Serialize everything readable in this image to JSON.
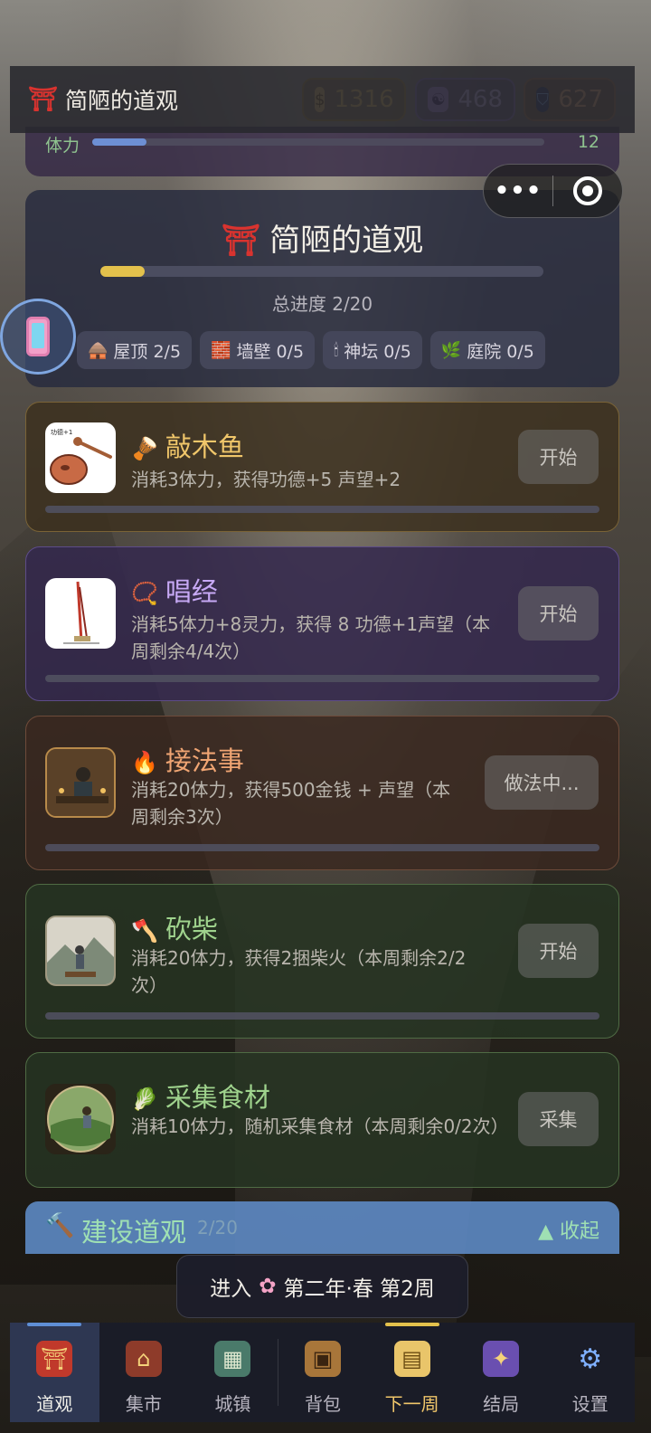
{
  "header": {
    "gate_icon": "torii-gate-icon",
    "title": "简陋的道观",
    "gold": "1316",
    "spirit": "468",
    "reputation": "627"
  },
  "stamina": {
    "label": "体力",
    "value": "12",
    "fill_fraction": 0.12
  },
  "temple": {
    "title": "简陋的道观",
    "progress_text": "总进度 2/20",
    "progress_fraction": 0.1,
    "parts": [
      {
        "icon": "🛖",
        "label": "屋顶 2/5"
      },
      {
        "icon": "🧱",
        "label": "墙壁 0/5"
      },
      {
        "icon": "🕯",
        "label": "神坛 0/5"
      },
      {
        "icon": "🌿",
        "label": "庭院 0/5"
      }
    ]
  },
  "tasks": [
    {
      "icon": "🪘",
      "title": "敲木鱼",
      "desc": "消耗3体力，获得功德+5 声望+2",
      "button": "开始",
      "thumb_caption": "功德+1"
    },
    {
      "icon": "📿",
      "title": "唱经",
      "desc": "消耗5体力+8灵力，获得 8 功德+1声望（本周剩余4/4次）",
      "button": "开始"
    },
    {
      "icon": "🔥",
      "title": "接法事",
      "desc": "消耗20体力，获得500金钱 + 声望（本周剩余3次）",
      "button": "做法中..."
    },
    {
      "icon": "🪓",
      "title": "砍柴",
      "desc": "消耗20体力，获得2捆柴火（本周剩余2/2次）",
      "button": "开始"
    },
    {
      "icon": "🥬",
      "title": "采集食材",
      "desc": "消耗10体力，随机采集食材（本周剩余0/2次）",
      "button": "采集"
    }
  ],
  "build": {
    "label": "建设道观",
    "count": "2/20",
    "collapse": "▲ 收起"
  },
  "toast": {
    "prefix": "进入",
    "text": "第二年·春 第2周"
  },
  "nav": [
    {
      "label": "道观",
      "active": true
    },
    {
      "label": "集市"
    },
    {
      "label": "城镇"
    },
    {
      "label": "背包"
    },
    {
      "label": "下一周"
    },
    {
      "label": "结局"
    },
    {
      "label": "设置"
    }
  ],
  "colors": {
    "gold": "#f3cd62",
    "spirit": "#cfb8ff",
    "reputation": "#f1b479",
    "progress": "#e3c14c",
    "active_tab_indicator": "#5f8fd6",
    "next_week_indicator": "#e3c14c"
  }
}
